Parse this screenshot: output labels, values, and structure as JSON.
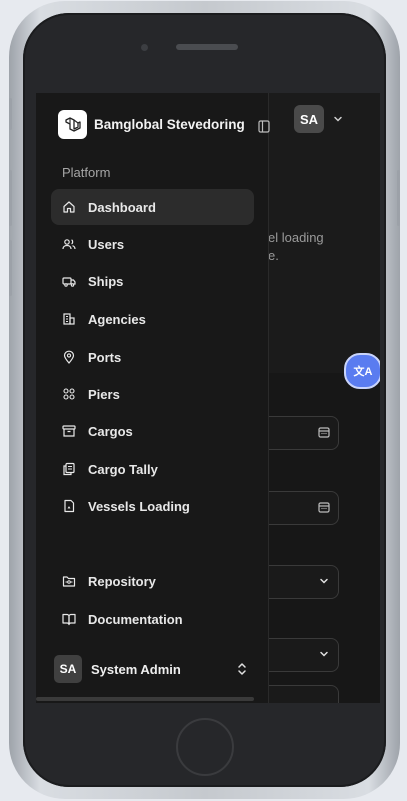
{
  "app": {
    "brand_name": "Bamglobal Stevedoring",
    "user_initials": "SA"
  },
  "sidebar": {
    "group_label": "Platform",
    "items": [
      {
        "label": "Dashboard",
        "icon": "home-icon",
        "active": true
      },
      {
        "label": "Users",
        "icon": "users-icon"
      },
      {
        "label": "Ships",
        "icon": "truck-icon"
      },
      {
        "label": "Agencies",
        "icon": "building-icon"
      },
      {
        "label": "Ports",
        "icon": "map-pin-icon"
      },
      {
        "label": "Piers",
        "icon": "grid-icon"
      },
      {
        "label": "Cargos",
        "icon": "archive-icon"
      },
      {
        "label": "Cargo Tally",
        "icon": "copy-icon"
      },
      {
        "label": "Vessels Loading",
        "icon": "file-icon"
      }
    ],
    "footer_items": [
      {
        "label": "Repository",
        "icon": "folder-git-icon"
      },
      {
        "label": "Documentation",
        "icon": "book-icon"
      }
    ],
    "user": {
      "initials": "SA",
      "name": "System Admin"
    }
  },
  "main": {
    "partial_text_1": "el loading",
    "partial_text_2": "e.",
    "translate_button": "文A"
  }
}
